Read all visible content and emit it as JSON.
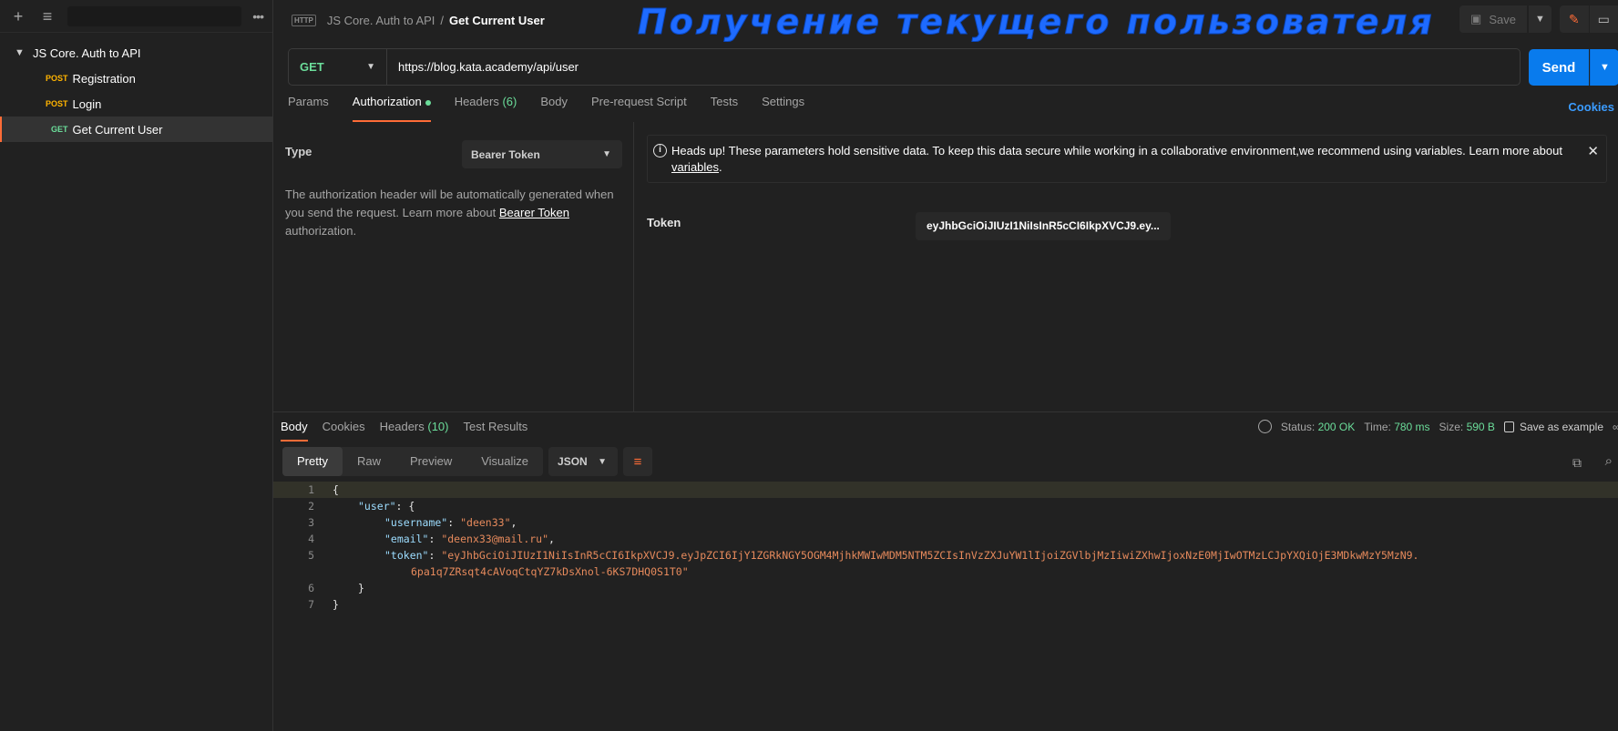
{
  "sidebar": {
    "collection_name": "JS Core. Auth to API",
    "items": [
      {
        "method": "POST",
        "label": "Registration"
      },
      {
        "method": "POST",
        "label": "Login"
      },
      {
        "method": "GET",
        "label": "Get Current User"
      }
    ]
  },
  "header": {
    "http_badge": "HTTP",
    "breadcrumb_parent": "JS Core. Auth to API",
    "breadcrumb_sep": "/",
    "title": "Get Current User",
    "overlay_title": "Получение текущего пользователя",
    "save_label": "Save"
  },
  "request": {
    "method": "GET",
    "url": "https://blog.kata.academy/api/user",
    "send_label": "Send",
    "tabs": [
      "Params",
      "Authorization",
      "Headers",
      "Body",
      "Pre-request Script",
      "Tests",
      "Settings"
    ],
    "headers_count": "(6)",
    "cookies_label": "Cookies"
  },
  "auth": {
    "type_label": "Type",
    "type_value": "Bearer Token",
    "desc_prefix": "The authorization header will be automatically generated when you send the request. Learn more about ",
    "desc_link": "Bearer Token",
    "desc_suffix": " authorization.",
    "headsup_text": "Heads up! These parameters hold sensitive data. To keep this data secure while working in a collaborative environment,we recommend using variables. Learn more about ",
    "headsup_link": "variables",
    "headsup_end": ".",
    "token_label": "Token",
    "token_value": "eyJhbGciOiJIUzI1NiIsInR5cCI6IkpXVCJ9.ey..."
  },
  "response": {
    "tabs": [
      "Body",
      "Cookies",
      "Headers",
      "Test Results"
    ],
    "headers_count": "(10)",
    "status_label": "Status:",
    "status_value": "200 OK",
    "time_label": "Time:",
    "time_value": "780 ms",
    "size_label": "Size:",
    "size_value": "590 B",
    "save_example": "Save as example",
    "view_modes": [
      "Pretty",
      "Raw",
      "Preview",
      "Visualize"
    ],
    "format": "JSON",
    "lines": [
      {
        "n": "1",
        "text": "{"
      },
      {
        "n": "2",
        "key": "\"user\"",
        "rest": ": {"
      },
      {
        "n": "3",
        "key": "\"username\"",
        "value": "\"deen33\"",
        "end": ","
      },
      {
        "n": "4",
        "key": "\"email\"",
        "value": "\"deenx33@mail.ru\"",
        "end": ","
      },
      {
        "n": "5",
        "key": "\"token\"",
        "value": "\"eyJhbGciOiJIUzI1NiIsInR5cCI6IkpXVCJ9.eyJpZCI6IjY1ZGRkNGY5OGM4MjhkMWIwMDM5NTM5ZCIsInVzZXJuYW1lIjoiZGVlbjMzIiwiZXhwIjoxNzE0MjIwOTMzLCJpYXQiOjE3MDkwMzY5MzN9.",
        "cont": "6pa1q7ZRsqt4cAVoqCtqYZ7kDsXnol-6KS7DHQ0S1T0\""
      },
      {
        "n": "6",
        "text": "}"
      },
      {
        "n": "7",
        "text": "}"
      }
    ]
  },
  "colors": {
    "accent": "#ff6c37",
    "send": "#097bed",
    "get": "#6bdd9a",
    "post": "#ffb400",
    "overlay": "#1e6bff"
  }
}
